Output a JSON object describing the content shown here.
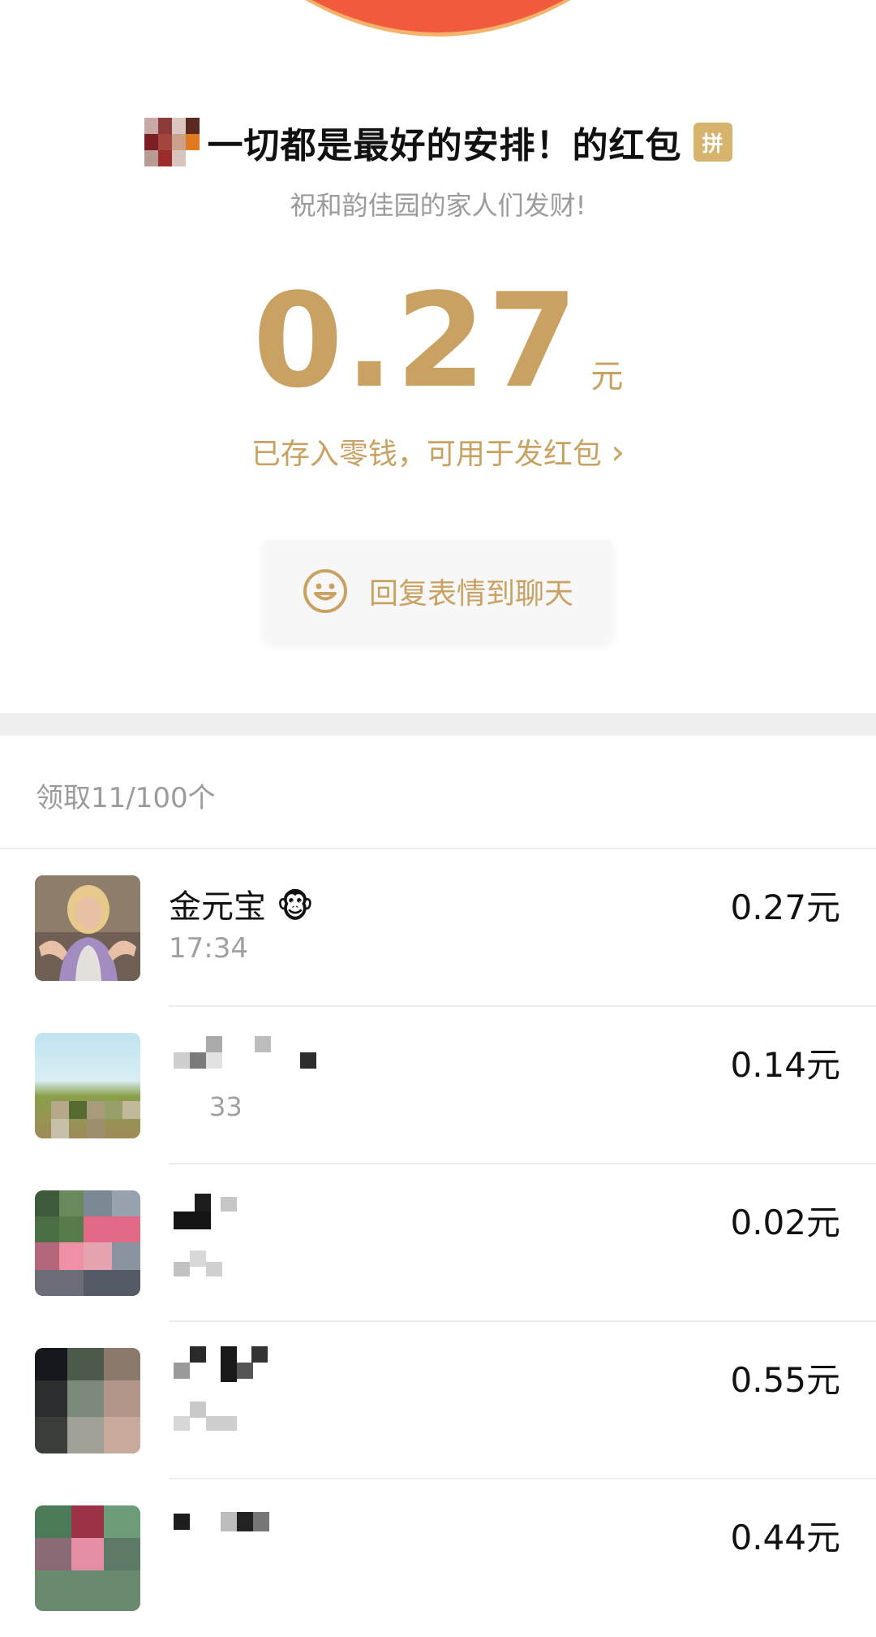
{
  "header": {
    "sender_title": "一切都是最好的安排！的红包",
    "badge": "拼",
    "greeting": "祝和韵佳园的家人们发财!"
  },
  "amount": {
    "value": "0.27",
    "unit": "元",
    "saved_note": "已存入零钱，可用于发红包",
    "chevron": "›"
  },
  "reply": {
    "icon": "smile-icon",
    "label": "回复表情到聊天"
  },
  "claims": {
    "count_label": "领取11/100个",
    "records": [
      {
        "name": "金元宝 🐵",
        "time": "17:34",
        "amount": "0.27元"
      },
      {
        "name": "",
        "time": "33",
        "amount": "0.14元"
      },
      {
        "name": "",
        "time": "",
        "amount": "0.02元"
      },
      {
        "name": "",
        "time": "",
        "amount": "0.55元"
      },
      {
        "name": "",
        "time": "",
        "amount": "0.44元"
      }
    ]
  },
  "colors": {
    "accent_gold": "#c9a263",
    "top_red": "#f25a3e",
    "badge_gold": "#d7b46d"
  }
}
